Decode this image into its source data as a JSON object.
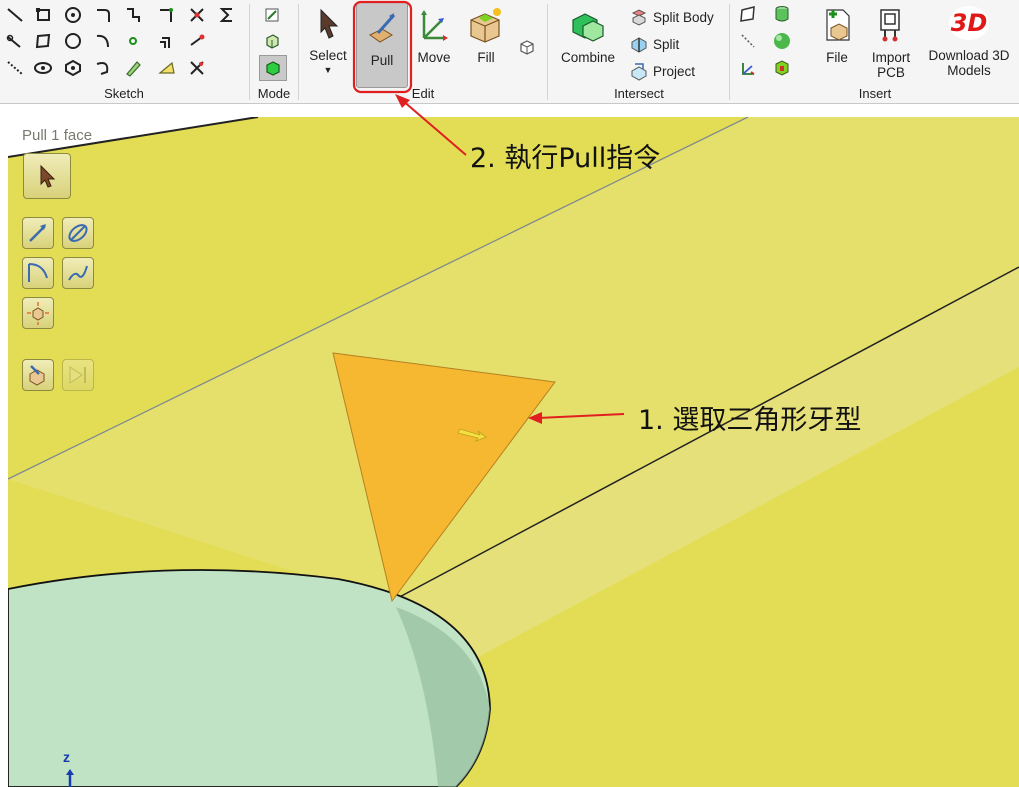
{
  "ribbon": {
    "groups": {
      "sketch": "Sketch",
      "mode": "Mode",
      "edit": "Edit",
      "intersect": "Intersect",
      "insert": "Insert"
    },
    "edit": {
      "select": "Select",
      "pull": "Pull",
      "move": "Move",
      "fill": "Fill"
    },
    "intersect": {
      "combine": "Combine",
      "split_body": "Split Body",
      "split": "Split",
      "project": "Project"
    },
    "insert": {
      "file": "File",
      "import_pcb": "Import PCB",
      "download_3d": "Download 3D Models",
      "badge_3d": "3D"
    }
  },
  "viewport": {
    "mode_title": "Pull 1 face",
    "axis_label": "z"
  },
  "annotations": {
    "step1": "1. 選取三角形牙型",
    "step2": "2. 執行Pull指令"
  },
  "colors": {
    "highlight": "#e02020",
    "selected_face": "#f5b830",
    "body_yellow": "#e6e05a",
    "cylinder_green": "#bfe3c4"
  }
}
